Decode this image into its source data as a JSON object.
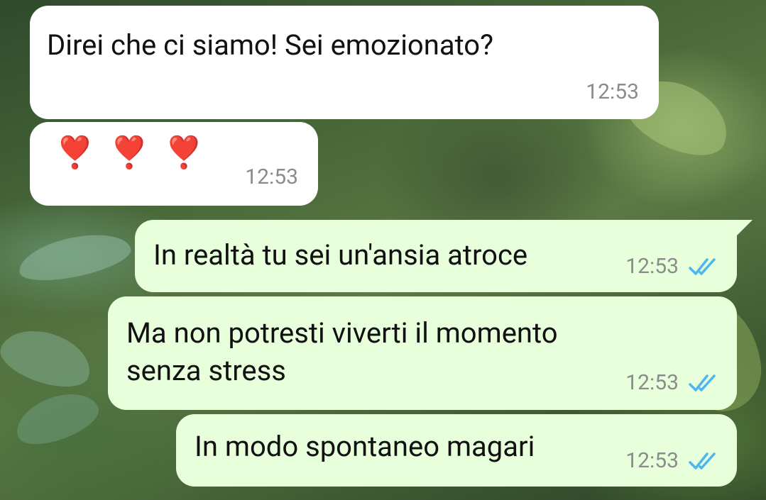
{
  "messages": [
    {
      "direction": "incoming",
      "text": "Direi che ci siamo! Sei emozionato?",
      "time": "12:53"
    },
    {
      "direction": "incoming",
      "text": "❣️❣️❣️",
      "time": "12:53"
    },
    {
      "direction": "outgoing",
      "text": "In realtà tu sei un'ansia atroce",
      "time": "12:53",
      "status": "read"
    },
    {
      "direction": "outgoing",
      "text": "Ma non potresti viverti il momento\nsenza stress",
      "time": "12:53",
      "status": "read"
    },
    {
      "direction": "outgoing",
      "text": "In modo spontaneo magari",
      "time": "12:53",
      "status": "read"
    }
  ],
  "colors": {
    "incoming_bubble": "#ffffff",
    "outgoing_bubble": "#e7ffdb",
    "read_ticks": "#4fb6ec",
    "timestamp": "#8b8b8b"
  },
  "icons": {
    "read_receipt": "double-check-icon"
  }
}
